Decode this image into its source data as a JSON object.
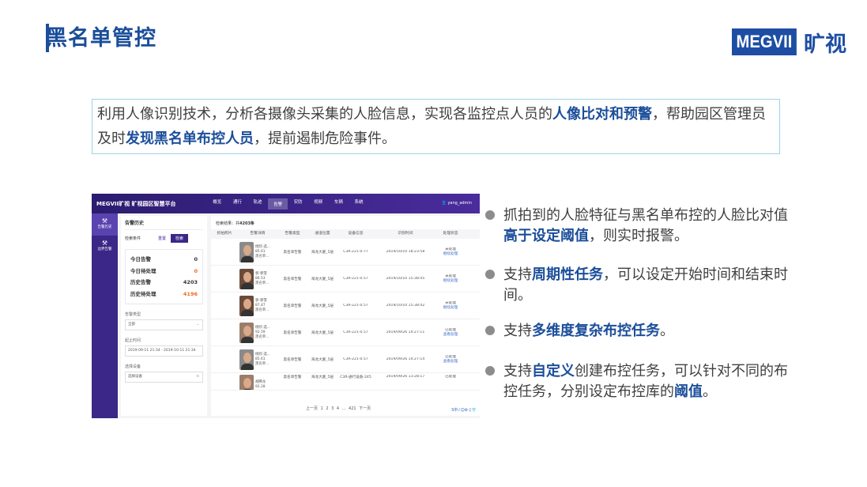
{
  "slide": {
    "title": "黑名单管控",
    "logo_text": "MEGVII",
    "logo_cn": "旷视"
  },
  "intro": {
    "p1": "利用人像识别技术，分析各摄像头采集的人脸信息，实现各监控点人员的",
    "h1": "人像比对和预警",
    "p2": "，帮助园区管理员及时",
    "h2": "发现黑名单布控人员",
    "p3": "，提前遏制危险事件。"
  },
  "bullets": [
    {
      "pre": "抓拍到的人脸特征与黑名单布控的人脸比对值",
      "hl": "高于设定阈值",
      "post": "，则实时报警。"
    },
    {
      "pre": "支持",
      "hl": "周期性任务",
      "post": "，可以设定开始时间和结束时间。"
    },
    {
      "pre": "支持",
      "hl": "多维度复杂布控任务",
      "post": "。"
    },
    {
      "pre": "支持",
      "hl": "自定义",
      "post": "创建布控任务，可以针对不同的布控任务，分别设定布控库的",
      "hl2": "阈值",
      "post2": "。"
    }
  ],
  "app": {
    "brand": "MEGVII旷视  旷视园区智慧平台",
    "nav": [
      "概览",
      "通行",
      "轨迹",
      "告警",
      "安防",
      "视频",
      "车辆",
      "系统"
    ],
    "active_nav": "告警",
    "user": "yang_admin",
    "sidenav": [
      {
        "icon": "alarm-history-icon",
        "label": "告警历史"
      },
      {
        "icon": "alarm-config-icon",
        "label": "边界告警"
      }
    ],
    "panel_title": "告警历史",
    "condition_label": "检索条件",
    "reset_label": "重置",
    "search_label": "检索",
    "stats": [
      {
        "label": "今日告警",
        "value": "0"
      },
      {
        "label": "今日待处理",
        "value": "0"
      },
      {
        "label": "历史告警",
        "value": "4203"
      },
      {
        "label": "历史待处理",
        "value": "4196"
      }
    ],
    "type_label": "告警类型",
    "type_value": "全部",
    "time_label": "起止时间",
    "time_value": "2019-09-11 21:34 - 2019-10-11 21:34",
    "device_label": "选择设备",
    "device_placeholder": "选择设备",
    "result_prefix": "检索结果：共",
    "result_count": "4203条",
    "columns": [
      "抓拍照片",
      "告警详情",
      "告警类型",
      "通道位置",
      "设备信息",
      "识别时间",
      "处理状态"
    ],
    "rows": [
      {
        "name": "杨欣-选...",
        "score": "85.61",
        "lib": "黑名单...",
        "type": "黑名单告警",
        "loc": "海龙大厦_5层",
        "device": "C3R-221-0.77",
        "time": "2019/10/10 18:23:58",
        "s1": "未处理",
        "s2": "继续处理"
      },
      {
        "name": "郭-郭雪",
        "score": "86.53",
        "lib": "黑名单...",
        "type": "黑名单告警",
        "loc": "海龙大厦_5层",
        "device": "C3R-221-0.57",
        "time": "2019/10/10 15:38:45",
        "s1": "未处理",
        "s2": "继续处理"
      },
      {
        "name": "郭-郭雪",
        "score": "87.47",
        "lib": "黑名单...",
        "type": "黑名单告警",
        "loc": "海龙大厦_5层",
        "device": "C3R-221-0.57",
        "time": "2019/10/10 15:38:42",
        "s1": "未处理",
        "s2": "继续处理"
      },
      {
        "name": "杨欣-选...",
        "score": "92.59",
        "lib": "黑名单...",
        "type": "黑名单告警",
        "loc": "海龙大厦_5层",
        "device": "C3R-221-0.57",
        "time": "2019/09/26 14:27:11",
        "s1": "已处理",
        "s2": "查看处理"
      },
      {
        "name": "杨欣-选...",
        "score": "85.61",
        "lib": "黑名单...",
        "type": "黑名单告警",
        "loc": "海龙大厦_5层",
        "device": "C3R-221-0.57",
        "time": "2019/09/26 14:27:14",
        "s1": "已处理",
        "s2": "查看处理"
      },
      {
        "name": "胡腾龙",
        "score": "92.28",
        "lib": "",
        "type": "黑名单告警",
        "loc": "海龙大厦_5层",
        "device": "C3R-通行设备-245",
        "time": "2019/09/26 13:28:17",
        "s1": "已处理",
        "s2": ""
      }
    ],
    "pager": "上一页  1  2  3  4  ...  421  下一页"
  }
}
